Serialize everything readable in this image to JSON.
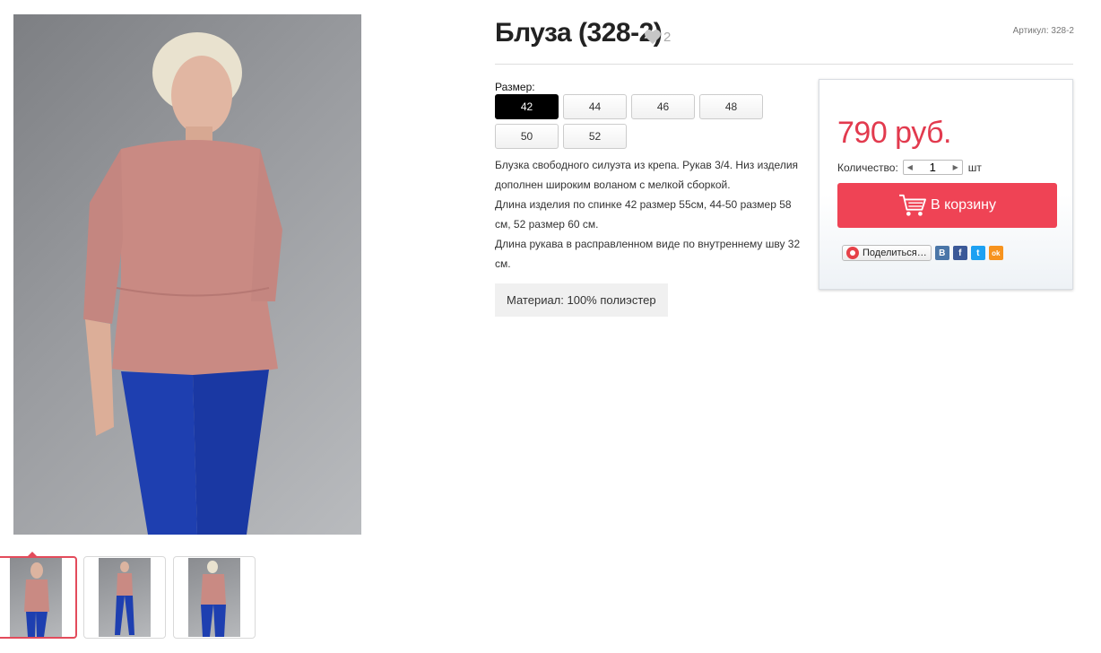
{
  "product": {
    "title": "Блуза (328-2)",
    "likes": "2",
    "article": "Артикул: 328-2"
  },
  "sizes": {
    "label": "Размер:",
    "options": [
      "42",
      "44",
      "46",
      "48",
      "50",
      "52"
    ],
    "selected": "42"
  },
  "description": [
    "Блузка свободного силуэта из крепа. Рукав 3/4. Низ изделия дополнен широким воланом с мелкой сборкой.",
    "Длина изделия по спинке 42 размер 55см, 44-50 размер 58 см, 52 размер 60 см.",
    "Длина рукава в расправленном виде по внутреннему шву 32 см."
  ],
  "material": "Материал: 100% полиэстер",
  "buy": {
    "price": "790 руб.",
    "quantity_label": "Количество:",
    "quantity_value": "1",
    "quantity_unit": "шт",
    "cart_label": "В корзину",
    "share_label": "Поделиться…"
  },
  "social": [
    {
      "name": "vk",
      "glyph": "В",
      "color": "#4a76a8"
    },
    {
      "name": "facebook",
      "glyph": "f",
      "color": "#3b5998"
    },
    {
      "name": "twitter",
      "glyph": "t",
      "color": "#1da1f2"
    },
    {
      "name": "odnoklassniki",
      "glyph": "ok",
      "color": "#f7931e"
    }
  ],
  "colors": {
    "accent": "#ef4355",
    "price": "#e23a4e",
    "blouse": "#c98a83",
    "trousers": "#1e3fb0"
  }
}
